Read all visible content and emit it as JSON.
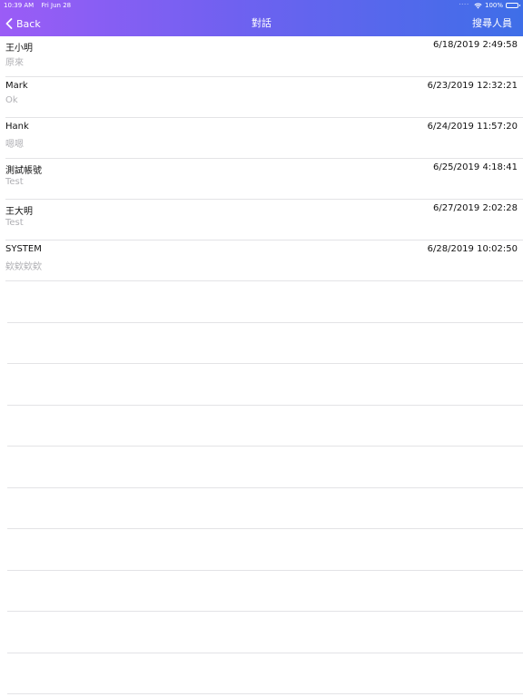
{
  "status_bar": {
    "time": "10:39 AM",
    "date": "Fri Jun 28",
    "battery": "100%"
  },
  "nav": {
    "back_label": "Back",
    "title": "對話",
    "right_action": "搜尋人員"
  },
  "conversations": [
    {
      "name": "王小明",
      "message": "原來",
      "time": "6/18/2019 2:49:58"
    },
    {
      "name": "Mark",
      "message": "Ok",
      "time": "6/23/2019 12:32:21"
    },
    {
      "name": "Hank",
      "message": "嗯嗯",
      "time": "6/24/2019 11:57:20"
    },
    {
      "name": "測試帳號",
      "message": "Test",
      "time": "6/25/2019 4:18:41"
    },
    {
      "name": "王大明",
      "message": "Test",
      "time": "6/27/2019 2:02:28"
    },
    {
      "name": "SYSTEM",
      "message": "欸欸欸欸",
      "time": "6/28/2019 10:02:50"
    }
  ],
  "colors": {
    "header_gradient_start": "#9b5cf6",
    "header_gradient_end": "#3e6ee8",
    "secondary_text": "#b0b0b4"
  }
}
